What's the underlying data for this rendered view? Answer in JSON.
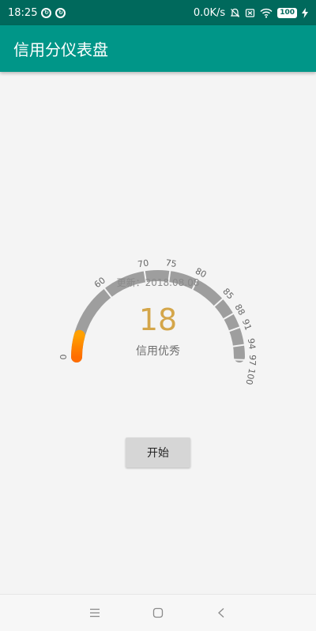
{
  "status_bar": {
    "time": "18:25",
    "net_speed": "0.0K/s",
    "battery": "100",
    "icons": [
      "sync-icon",
      "sync-icon",
      "mute-icon",
      "sim-off-icon",
      "wifi-icon",
      "battery-icon",
      "charging-icon"
    ]
  },
  "app_bar": {
    "title": "信用分仪表盘"
  },
  "gauge": {
    "update_label": "更新：2018.08.08",
    "score": "18",
    "status": "信用优秀",
    "progress_fraction": 0.085,
    "tick_labels": [
      "0",
      "60",
      "70",
      "75",
      "80",
      "85",
      "88",
      "91",
      "94",
      "97",
      "100"
    ],
    "colors": {
      "track": "#9e9e9e",
      "progress_start": "#ff6d00",
      "progress_end": "#ffa000",
      "score": "#d4a64a"
    }
  },
  "buttons": {
    "start": "开始"
  },
  "nav_bar": {
    "icons": [
      "menu-icon",
      "home-icon",
      "back-icon"
    ]
  }
}
